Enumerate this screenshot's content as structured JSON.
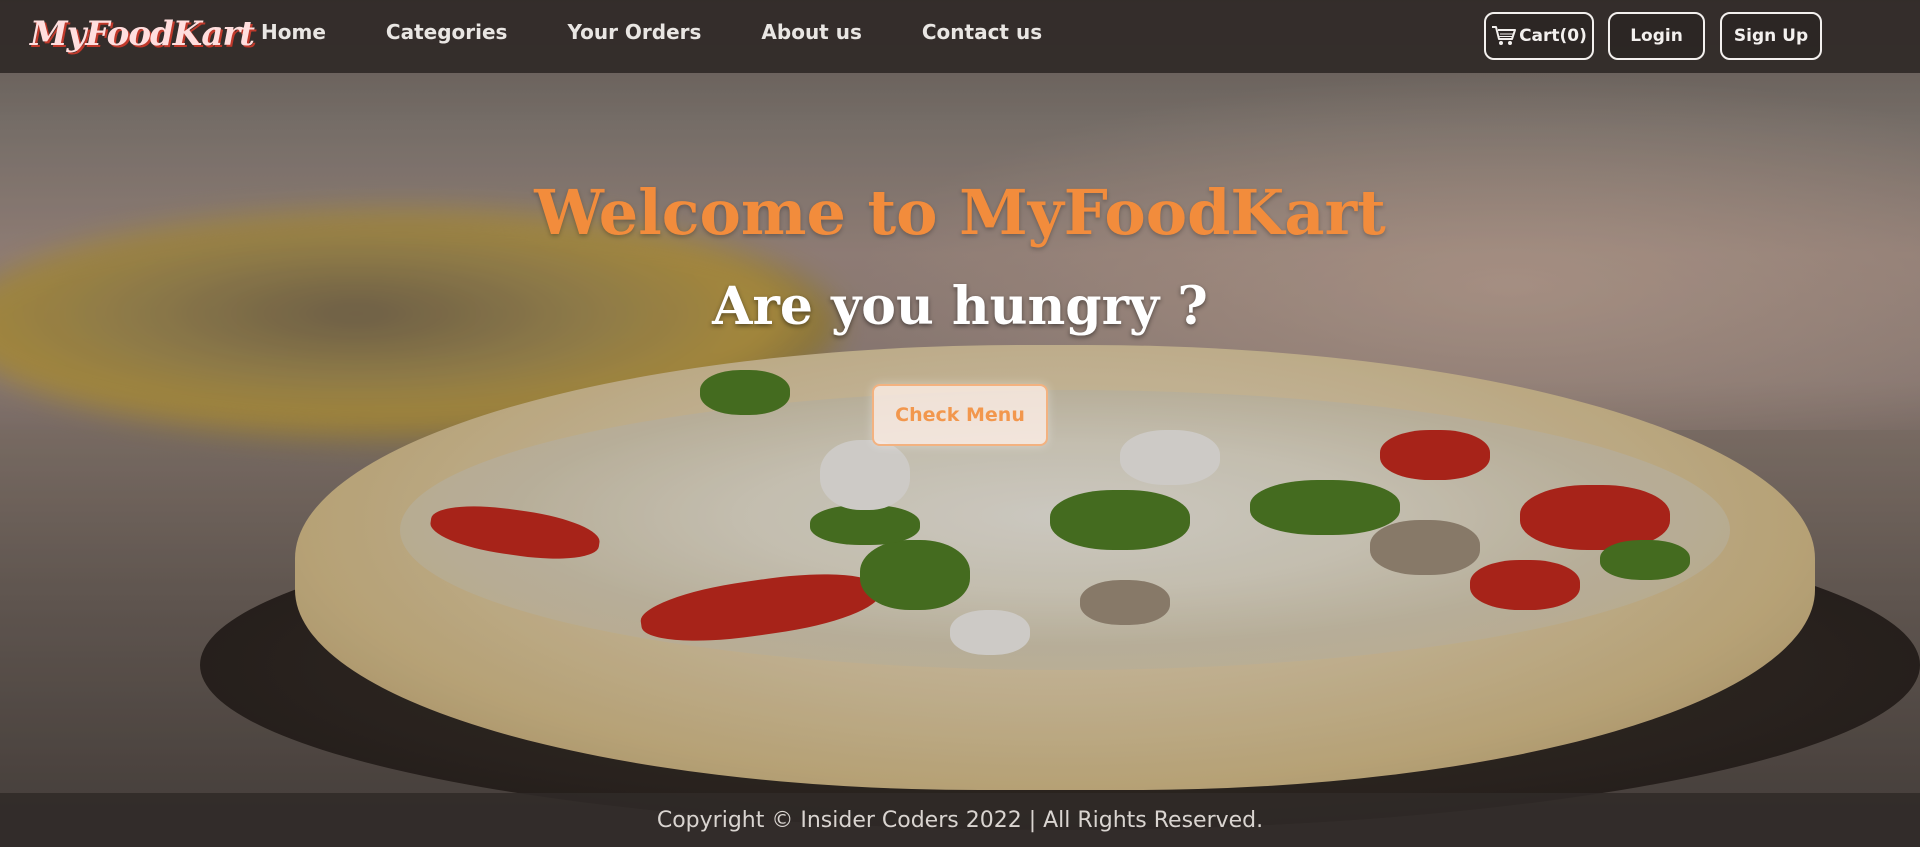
{
  "brand": {
    "name": "MyFoodKart"
  },
  "nav": {
    "links": [
      "Home",
      "Categories",
      "Your Orders",
      "About us",
      "Contact us"
    ],
    "cart_label": "Cart(0)",
    "login_label": "Login",
    "signup_label": "Sign Up"
  },
  "hero": {
    "title": "Welcome to MyFoodKart",
    "subtitle": "Are you hungry ?",
    "cta_label": "Check Menu"
  },
  "footer": {
    "text": "Copyright © Insider Coders 2022 | All Rights Reserved."
  },
  "colors": {
    "accent": "#f28c3c",
    "navbar": "#302a28",
    "text_light": "#ffffff"
  },
  "icons": {
    "cart": "shopping-cart-icon"
  }
}
